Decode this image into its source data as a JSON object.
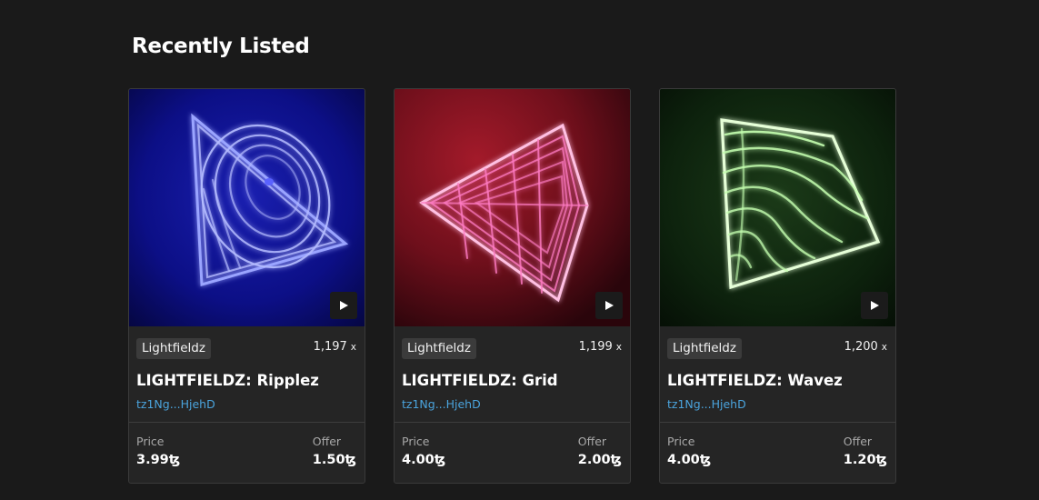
{
  "section": {
    "title": "Recently Listed"
  },
  "cards": [
    {
      "collection": "Lightfieldz",
      "edition": "1,197",
      "edition_suffix": "x",
      "title": "LIGHTFIELDZ: Ripplez",
      "artist": "tz1Ng...HjehD",
      "price_label": "Price",
      "price": "3.99ꜩ",
      "offer_label": "Offer",
      "offer": "1.50ꜩ",
      "art_icon": "ripplez-artwork",
      "colors": {
        "background": "#0d1177",
        "glow": "#8f9bff"
      }
    },
    {
      "collection": "Lightfieldz",
      "edition": "1,199",
      "edition_suffix": "x",
      "title": "LIGHTFIELDZ: Grid",
      "artist": "tz1Ng...HjehD",
      "price_label": "Price",
      "price": "4.00ꜩ",
      "offer_label": "Offer",
      "offer": "2.00ꜩ",
      "art_icon": "grid-artwork",
      "colors": {
        "background": "#6a0e1a",
        "glow": "#ff4fa8"
      }
    },
    {
      "collection": "Lightfieldz",
      "edition": "1,200",
      "edition_suffix": "x",
      "title": "LIGHTFIELDZ: Wavez",
      "artist": "tz1Ng...HjehD",
      "price_label": "Price",
      "price": "4.00ꜩ",
      "offer_label": "Offer",
      "offer": "1.20ꜩ",
      "art_icon": "wavez-artwork",
      "colors": {
        "background": "#0c240c",
        "glow": "#9cff7a"
      }
    }
  ]
}
